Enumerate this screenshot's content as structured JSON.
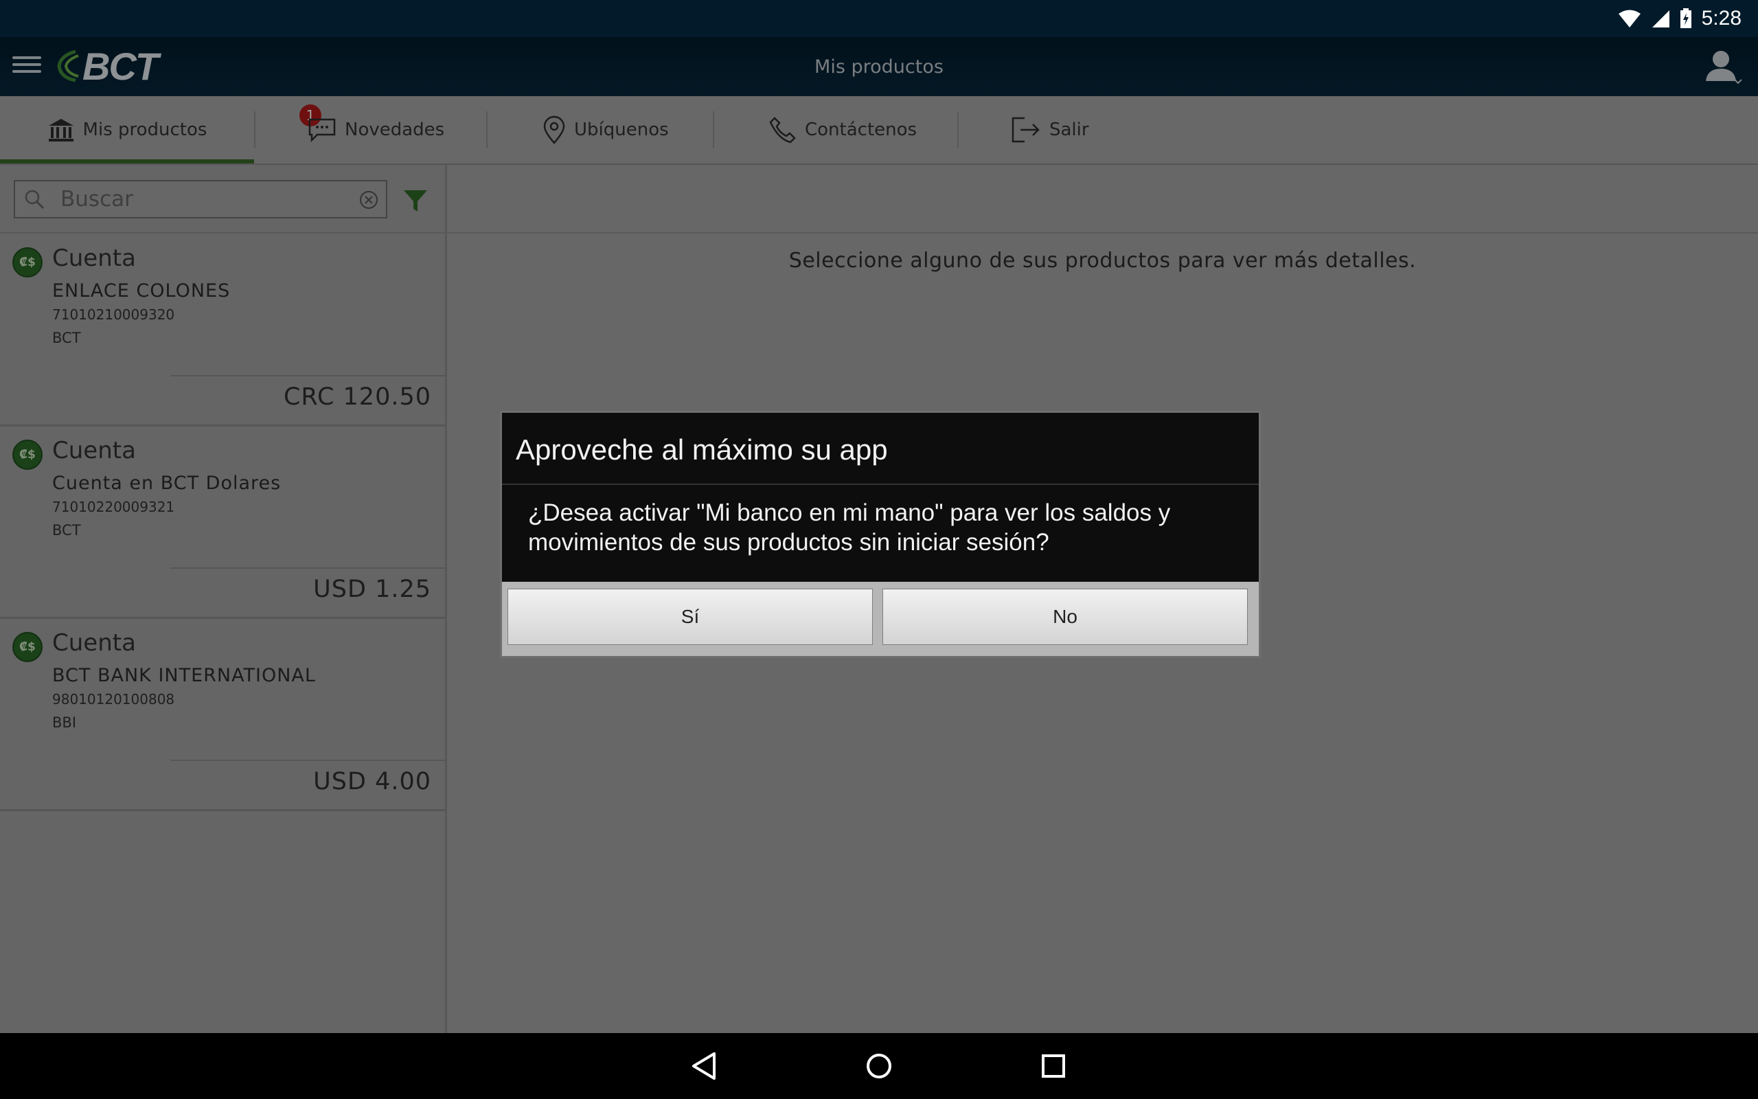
{
  "status_bar": {
    "time": "5:28"
  },
  "app_bar": {
    "logo": "BCT",
    "title": "Mis productos"
  },
  "tabs": [
    {
      "label": "Mis productos",
      "icon": "bank-icon"
    },
    {
      "label": "Novedades",
      "icon": "chat-icon",
      "badge": "1"
    },
    {
      "label": "Ubíquenos",
      "icon": "location-pin-icon"
    },
    {
      "label": "Contáctenos",
      "icon": "phone-icon"
    },
    {
      "label": "Salir",
      "icon": "logout-icon"
    }
  ],
  "search": {
    "placeholder": "Buscar"
  },
  "products": [
    {
      "type": "Cuenta",
      "name": "ENLACE COLONES",
      "number": "71010210009320",
      "bank": "BCT",
      "balance": "CRC 120.50"
    },
    {
      "type": "Cuenta",
      "name": "Cuenta en BCT Dolares",
      "number": "71010220009321",
      "bank": "BCT",
      "balance": "USD 1.25"
    },
    {
      "type": "Cuenta",
      "name": "BCT BANK INTERNATIONAL",
      "number": "98010120100808",
      "bank": "BBI",
      "balance": "USD 4.00"
    }
  ],
  "main": {
    "message": "Seleccione alguno de sus productos para ver más detalles."
  },
  "dialog": {
    "title": "Aproveche al máximo su app",
    "message": "¿Desea activar \"Mi banco en mi mano\" para ver los saldos y movimientos de sus productos sin iniciar sesión?",
    "yes_label": "Sí",
    "no_label": "No"
  },
  "colors": {
    "accent": "#3a6b2a",
    "badge": "#b21b1b",
    "appbar": "#031c2c"
  }
}
